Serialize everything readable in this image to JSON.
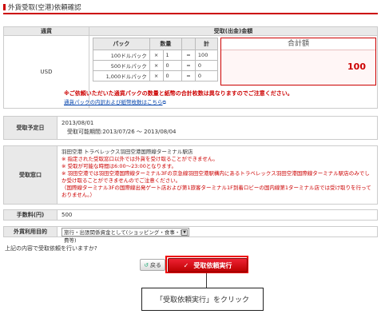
{
  "header": {
    "title": "外貨受取(空港)依頼確認"
  },
  "table": {
    "col_currency": "通貨",
    "col_amount": "受取(出金)金額",
    "currency": "USD",
    "pack_headers": [
      "パック",
      "数量",
      "",
      "計"
    ],
    "packs": [
      {
        "name": "100ドルパック",
        "x": "×",
        "qty": "1",
        "eq": "=",
        "total": "100"
      },
      {
        "name": "500ドルパック",
        "x": "×",
        "qty": "0",
        "eq": "=",
        "total": "0"
      },
      {
        "name": "1,000ドルパック",
        "x": "×",
        "qty": "0",
        "eq": "=",
        "total": "0"
      }
    ],
    "total_label": "合計額",
    "total_value": "100",
    "note": "※ご依頼いただいた通貨パックの数量と紙幣の合計枚数は異なりますのでご注意ください。",
    "link": "通貨パックの内訳および紙幣枚数はこちら"
  },
  "schedule": {
    "label": "受取予定日",
    "date": "2013/08/01",
    "period": "受取可能期間:2013/07/26 ～ 2013/08/04"
  },
  "counter": {
    "label": "受取窓口",
    "name": "羽田空港 トラベレックス羽田空港国際線ターミナル駅店",
    "notes": [
      "※ 指定された受取窓口以外では外貨を受け取ることができません。",
      "※ 受取が可能な時間は6:00～23:00となります。",
      "※ 羽田空港では羽田空港国際線ターミナル3Fの京急線羽田空港駅構内にあるトラベレックス羽田空港国際線ターミナル駅店のみでしか受け取ることができませんのでご注意ください。",
      "（国際線ターミナル3Fの国際線出発ゲート店および第1旅客ターミナル1F到着ロビーの国内線第1ターミナル店では受け取りを行っておりません。）"
    ]
  },
  "fee": {
    "label": "手数料(円)",
    "value": "500"
  },
  "purpose": {
    "label": "外貨利用目的",
    "value": "旅行・出張関係資金として(ショッピング・食事・旅費等)"
  },
  "confirm_question": "上記の内容で受取依頼を行いますか?",
  "buttons": {
    "back": "戻る",
    "execute": "受取依頼実行"
  },
  "callout": "「受取依頼実行」をクリック"
}
